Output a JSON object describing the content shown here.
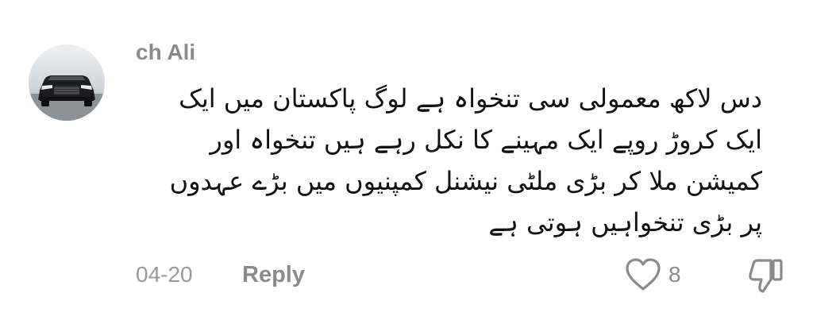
{
  "comment": {
    "username": "ch Ali",
    "avatar_icon": "car-icon",
    "lines": [
      "دس لاکھ معمولی سی تنخواہ ہے لوگ پاکستان میں ایک",
      "ایک کروڑ روپے ایک مہینے کا نکل رہے ہیں تنخواہ اور",
      "کمیشن ملا کر بڑی ملٹی نیشنل کمپنیوں میں بڑے عہدوں",
      "پر بڑی تنخواہیں ہوتی ہے"
    ],
    "date": "04-20",
    "reply_label": "Reply",
    "like_count": "8",
    "like_icon": "heart-outline-icon",
    "dislike_icon": "thumbs-down-icon"
  }
}
